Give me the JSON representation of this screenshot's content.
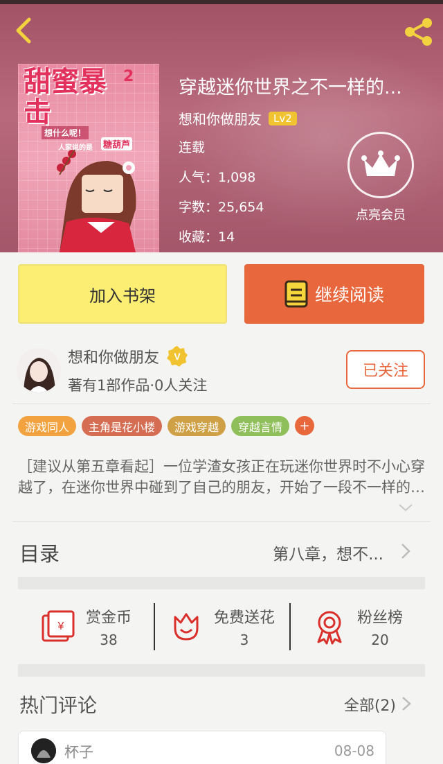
{
  "header": {
    "book_title": "穿越迷你世界之不一样的...",
    "author": "想和你做朋友",
    "author_level": "Lv2",
    "status": "连载",
    "popularity": "人气：1,098",
    "word_count": "字数：25,654",
    "favorites": "收藏：14",
    "vip_label": "点亮会员"
  },
  "cover": {
    "title_text": "甜蜜暴击",
    "title_number": "2",
    "subtitle": "想什么呢！",
    "subtitle2": "人家说的是",
    "highlight": "糖葫芦"
  },
  "actions": {
    "add_shelf": "加入书架",
    "continue_read": "继续阅读"
  },
  "author_block": {
    "name": "想和你做朋友",
    "stats": "著有1部作品·0人关注",
    "follow": "已关注"
  },
  "tags": [
    {
      "label": "游戏同人",
      "color": "#f2a23e"
    },
    {
      "label": "主角是花小楼",
      "color": "#d56d52"
    },
    {
      "label": "游戏穿越",
      "color": "#cfa045"
    },
    {
      "label": "穿越言情",
      "color": "#8fbf5a"
    }
  ],
  "tag_more": "+",
  "synopsis": "［建议从第五章看起］一位学渣女孩正在玩迷你世界时不小心穿越了，在迷你世界中碰到了自己的朋友，开始了一段不一样的冒险。",
  "toc": {
    "label": "目录",
    "latest": "第八章，想不..."
  },
  "stats": [
    {
      "label": "赏金币",
      "value": "38",
      "icon": "red-envelope-icon"
    },
    {
      "label": "免费送花",
      "value": "3",
      "icon": "flower-icon"
    },
    {
      "label": "粉丝榜",
      "value": "20",
      "icon": "medal-icon"
    }
  ],
  "comments": {
    "heading": "热门评论",
    "all": "全部(2)",
    "items": [
      {
        "user": "杯子",
        "date": "08-08"
      }
    ]
  },
  "colors": {
    "accent": "#e9673d",
    "shelf_button": "#fbee72",
    "header_bg": "#a25265"
  }
}
